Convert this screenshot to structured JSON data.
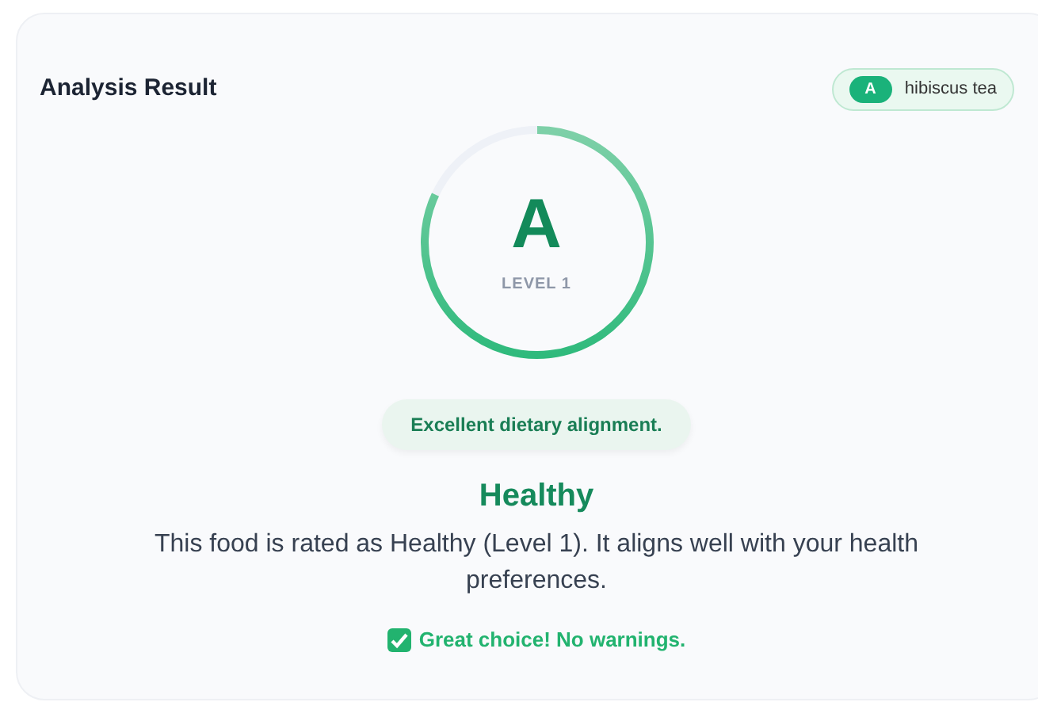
{
  "card": {
    "title": "Analysis Result"
  },
  "badge": {
    "grade": "A",
    "food": "hibiscus tea"
  },
  "score": {
    "grade": "A",
    "label": "LEVEL 1"
  },
  "summary_pill": "Excellent dietary alignment.",
  "rating": "Healthy",
  "description": "This food is rated as Healthy (Level 1). It aligns well with your health preferences.",
  "note": {
    "text": "Great choice! No warnings.",
    "checked": true
  }
}
